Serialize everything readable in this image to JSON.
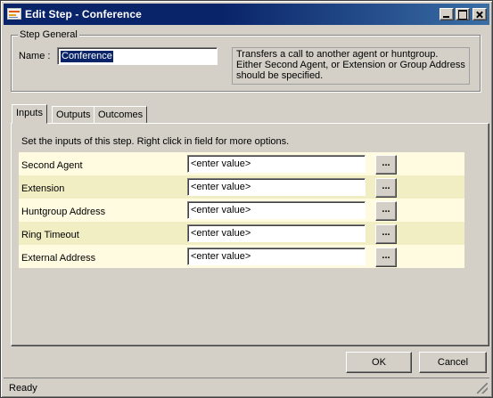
{
  "window": {
    "title": "Edit Step - Conference"
  },
  "step_general": {
    "legend": "Step General",
    "name_label": "Name :",
    "name_value": "Conference",
    "description_lines": [
      "Transfers a call to another agent or huntgroup.",
      "Either Second Agent, or Extension or Group Address",
      "should be specified."
    ]
  },
  "tabs": [
    {
      "label": "Inputs",
      "active": true
    },
    {
      "label": "Outputs",
      "active": false
    },
    {
      "label": "Outcomes",
      "active": false
    }
  ],
  "inputs": {
    "instruction": "Set the inputs of this step.  Right click in field for more options.",
    "rows": [
      {
        "label": "Second Agent",
        "value": "<enter value>",
        "button": "..."
      },
      {
        "label": "Extension",
        "value": "<enter value>",
        "button": "..."
      },
      {
        "label": "Huntgroup Address",
        "value": "<enter value>",
        "button": "..."
      },
      {
        "label": "Ring Timeout",
        "value": "<enter value>",
        "button": "..."
      },
      {
        "label": "External Address",
        "value": "<enter value>",
        "button": "..."
      }
    ]
  },
  "buttons": {
    "ok": "OK",
    "cancel": "Cancel"
  },
  "status": {
    "text": "Ready"
  },
  "colors": {
    "titlebar": "#0a246a",
    "row_light": "#fffbe0",
    "row_dark": "#f2eec3",
    "face": "#d4d0c8"
  }
}
